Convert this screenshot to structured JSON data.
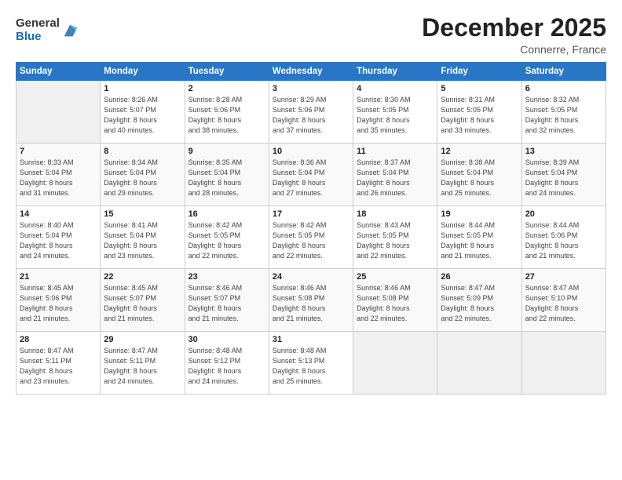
{
  "logo": {
    "general": "General",
    "blue": "Blue"
  },
  "title": "December 2025",
  "location": "Connerre, France",
  "days_header": [
    "Sunday",
    "Monday",
    "Tuesday",
    "Wednesday",
    "Thursday",
    "Friday",
    "Saturday"
  ],
  "weeks": [
    [
      {
        "num": "",
        "info": "",
        "empty": true
      },
      {
        "num": "1",
        "info": "Sunrise: 8:26 AM\nSunset: 5:07 PM\nDaylight: 8 hours\nand 40 minutes."
      },
      {
        "num": "2",
        "info": "Sunrise: 8:28 AM\nSunset: 5:06 PM\nDaylight: 8 hours\nand 38 minutes."
      },
      {
        "num": "3",
        "info": "Sunrise: 8:29 AM\nSunset: 5:06 PM\nDaylight: 8 hours\nand 37 minutes."
      },
      {
        "num": "4",
        "info": "Sunrise: 8:30 AM\nSunset: 5:05 PM\nDaylight: 8 hours\nand 35 minutes."
      },
      {
        "num": "5",
        "info": "Sunrise: 8:31 AM\nSunset: 5:05 PM\nDaylight: 8 hours\nand 33 minutes."
      },
      {
        "num": "6",
        "info": "Sunrise: 8:32 AM\nSunset: 5:05 PM\nDaylight: 8 hours\nand 32 minutes."
      }
    ],
    [
      {
        "num": "7",
        "info": "Sunrise: 8:33 AM\nSunset: 5:04 PM\nDaylight: 8 hours\nand 31 minutes."
      },
      {
        "num": "8",
        "info": "Sunrise: 8:34 AM\nSunset: 5:04 PM\nDaylight: 8 hours\nand 29 minutes."
      },
      {
        "num": "9",
        "info": "Sunrise: 8:35 AM\nSunset: 5:04 PM\nDaylight: 8 hours\nand 28 minutes."
      },
      {
        "num": "10",
        "info": "Sunrise: 8:36 AM\nSunset: 5:04 PM\nDaylight: 8 hours\nand 27 minutes."
      },
      {
        "num": "11",
        "info": "Sunrise: 8:37 AM\nSunset: 5:04 PM\nDaylight: 8 hours\nand 26 minutes."
      },
      {
        "num": "12",
        "info": "Sunrise: 8:38 AM\nSunset: 5:04 PM\nDaylight: 8 hours\nand 25 minutes."
      },
      {
        "num": "13",
        "info": "Sunrise: 8:39 AM\nSunset: 5:04 PM\nDaylight: 8 hours\nand 24 minutes."
      }
    ],
    [
      {
        "num": "14",
        "info": "Sunrise: 8:40 AM\nSunset: 5:04 PM\nDaylight: 8 hours\nand 24 minutes."
      },
      {
        "num": "15",
        "info": "Sunrise: 8:41 AM\nSunset: 5:04 PM\nDaylight: 8 hours\nand 23 minutes."
      },
      {
        "num": "16",
        "info": "Sunrise: 8:42 AM\nSunset: 5:05 PM\nDaylight: 8 hours\nand 22 minutes."
      },
      {
        "num": "17",
        "info": "Sunrise: 8:42 AM\nSunset: 5:05 PM\nDaylight: 8 hours\nand 22 minutes."
      },
      {
        "num": "18",
        "info": "Sunrise: 8:43 AM\nSunset: 5:05 PM\nDaylight: 8 hours\nand 22 minutes."
      },
      {
        "num": "19",
        "info": "Sunrise: 8:44 AM\nSunset: 5:05 PM\nDaylight: 8 hours\nand 21 minutes."
      },
      {
        "num": "20",
        "info": "Sunrise: 8:44 AM\nSunset: 5:06 PM\nDaylight: 8 hours\nand 21 minutes."
      }
    ],
    [
      {
        "num": "21",
        "info": "Sunrise: 8:45 AM\nSunset: 5:06 PM\nDaylight: 8 hours\nand 21 minutes."
      },
      {
        "num": "22",
        "info": "Sunrise: 8:45 AM\nSunset: 5:07 PM\nDaylight: 8 hours\nand 21 minutes."
      },
      {
        "num": "23",
        "info": "Sunrise: 8:46 AM\nSunset: 5:07 PM\nDaylight: 8 hours\nand 21 minutes."
      },
      {
        "num": "24",
        "info": "Sunrise: 8:46 AM\nSunset: 5:08 PM\nDaylight: 8 hours\nand 21 minutes."
      },
      {
        "num": "25",
        "info": "Sunrise: 8:46 AM\nSunset: 5:08 PM\nDaylight: 8 hours\nand 22 minutes."
      },
      {
        "num": "26",
        "info": "Sunrise: 8:47 AM\nSunset: 5:09 PM\nDaylight: 8 hours\nand 22 minutes."
      },
      {
        "num": "27",
        "info": "Sunrise: 8:47 AM\nSunset: 5:10 PM\nDaylight: 8 hours\nand 22 minutes."
      }
    ],
    [
      {
        "num": "28",
        "info": "Sunrise: 8:47 AM\nSunset: 5:11 PM\nDaylight: 8 hours\nand 23 minutes."
      },
      {
        "num": "29",
        "info": "Sunrise: 8:47 AM\nSunset: 5:11 PM\nDaylight: 8 hours\nand 24 minutes."
      },
      {
        "num": "30",
        "info": "Sunrise: 8:48 AM\nSunset: 5:12 PM\nDaylight: 8 hours\nand 24 minutes."
      },
      {
        "num": "31",
        "info": "Sunrise: 8:48 AM\nSunset: 5:13 PM\nDaylight: 8 hours\nand 25 minutes."
      },
      {
        "num": "",
        "info": "",
        "empty": true
      },
      {
        "num": "",
        "info": "",
        "empty": true
      },
      {
        "num": "",
        "info": "",
        "empty": true
      }
    ]
  ]
}
